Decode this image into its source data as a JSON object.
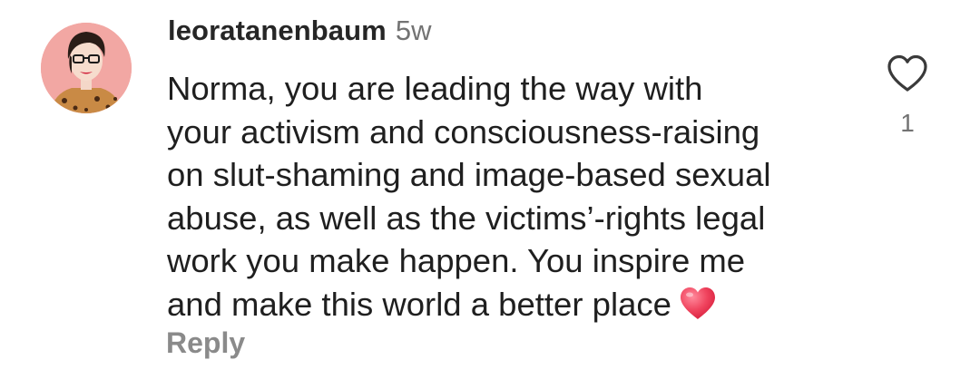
{
  "comment": {
    "username": "leoratanenbaum",
    "timestamp": "5w",
    "text_lines": [
      "Norma, you are leading the way with",
      "your activism and consciousness-raising",
      "on slut-shaming and image-based sexual",
      "abuse, as well as the victims’-rights legal",
      "work you make happen. You inspire me",
      "and make this world a better place"
    ],
    "emoji": "red-heart",
    "reply_label": "Reply",
    "like_count": "1",
    "like_icon": "heart-outline-icon"
  },
  "colors": {
    "username": "#262626",
    "timestamp": "#737373",
    "body_text": "#1f1f1f",
    "reply": "#8a8a8a",
    "avatar_background": "#f2a7a3",
    "heart_emoji": "#f0455f"
  }
}
